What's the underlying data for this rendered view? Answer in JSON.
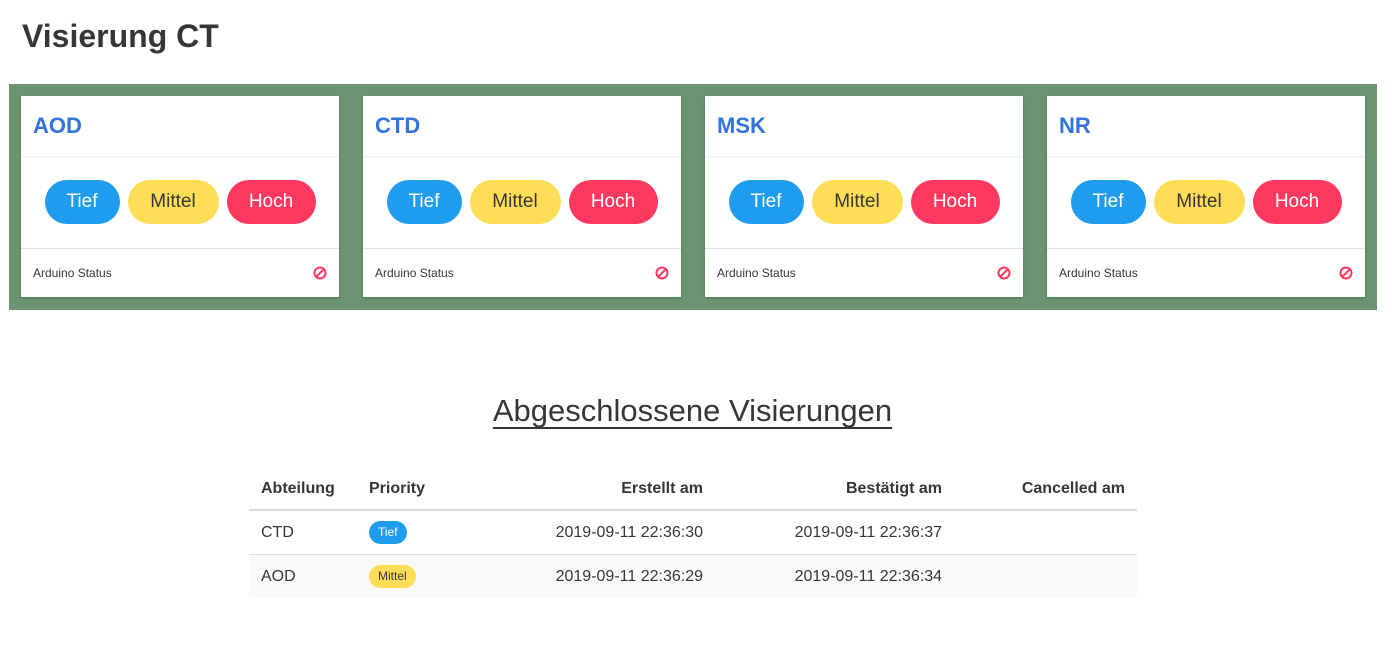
{
  "page": {
    "title": "Visierung CT"
  },
  "departments": [
    {
      "name": "AOD",
      "buttons": {
        "tief": "Tief",
        "mittel": "Mittel",
        "hoch": "Hoch"
      },
      "footer_label": "Arduino Status",
      "status_icon": "ban-icon"
    },
    {
      "name": "CTD",
      "buttons": {
        "tief": "Tief",
        "mittel": "Mittel",
        "hoch": "Hoch"
      },
      "footer_label": "Arduino Status",
      "status_icon": "ban-icon"
    },
    {
      "name": "MSK",
      "buttons": {
        "tief": "Tief",
        "mittel": "Mittel",
        "hoch": "Hoch"
      },
      "footer_label": "Arduino Status",
      "status_icon": "ban-icon"
    },
    {
      "name": "NR",
      "buttons": {
        "tief": "Tief",
        "mittel": "Mittel",
        "hoch": "Hoch"
      },
      "footer_label": "Arduino Status",
      "status_icon": "ban-icon"
    }
  ],
  "history": {
    "title": "Abgeschlossene Visierungen",
    "columns": [
      "Abteilung",
      "Priority",
      "Erstellt am",
      "Bestätigt am",
      "Cancelled am"
    ],
    "rows": [
      {
        "abteilung": "CTD",
        "priority": "Tief",
        "erstellt": "2019-09-11 22:36:30",
        "bestaetigt": "2019-09-11 22:36:37",
        "cancelled": ""
      },
      {
        "abteilung": "AOD",
        "priority": "Mittel",
        "erstellt": "2019-09-11 22:36:29",
        "bestaetigt": "2019-09-11 22:36:34",
        "cancelled": ""
      }
    ]
  },
  "colors": {
    "panel_background": "#6b9471",
    "title_blue": "#3273dc",
    "tief": "#209cee",
    "mittel": "#ffdd57",
    "hoch": "#ff3860"
  }
}
